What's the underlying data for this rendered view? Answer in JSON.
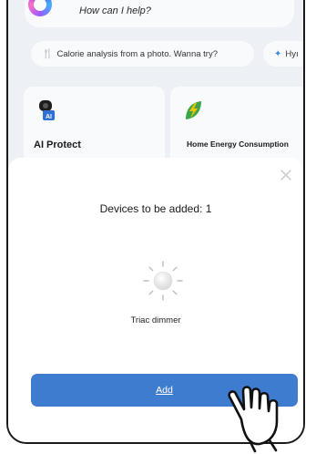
{
  "assistant": {
    "prompt": "How can I help?"
  },
  "suggestions": [
    {
      "icon": "fork-knife-icon",
      "label": "Calorie analysis from a photo. Wanna try?"
    },
    {
      "icon": "puzzle-icon",
      "label": "Hyı"
    }
  ],
  "cards": [
    {
      "icon": "ai-camera-icon",
      "title": "AI Protect"
    },
    {
      "icon": "energy-leaf-icon",
      "title": "Home Energy Consumption"
    }
  ],
  "sheet": {
    "title": "Devices to be added: 1",
    "device_name": "Triac dimmer",
    "add_label": "Add"
  },
  "colors": {
    "accent": "#3e7ccf",
    "background": "#edf0f5",
    "energy_green": "#3aa647",
    "energy_yellow": "#f2c200"
  }
}
